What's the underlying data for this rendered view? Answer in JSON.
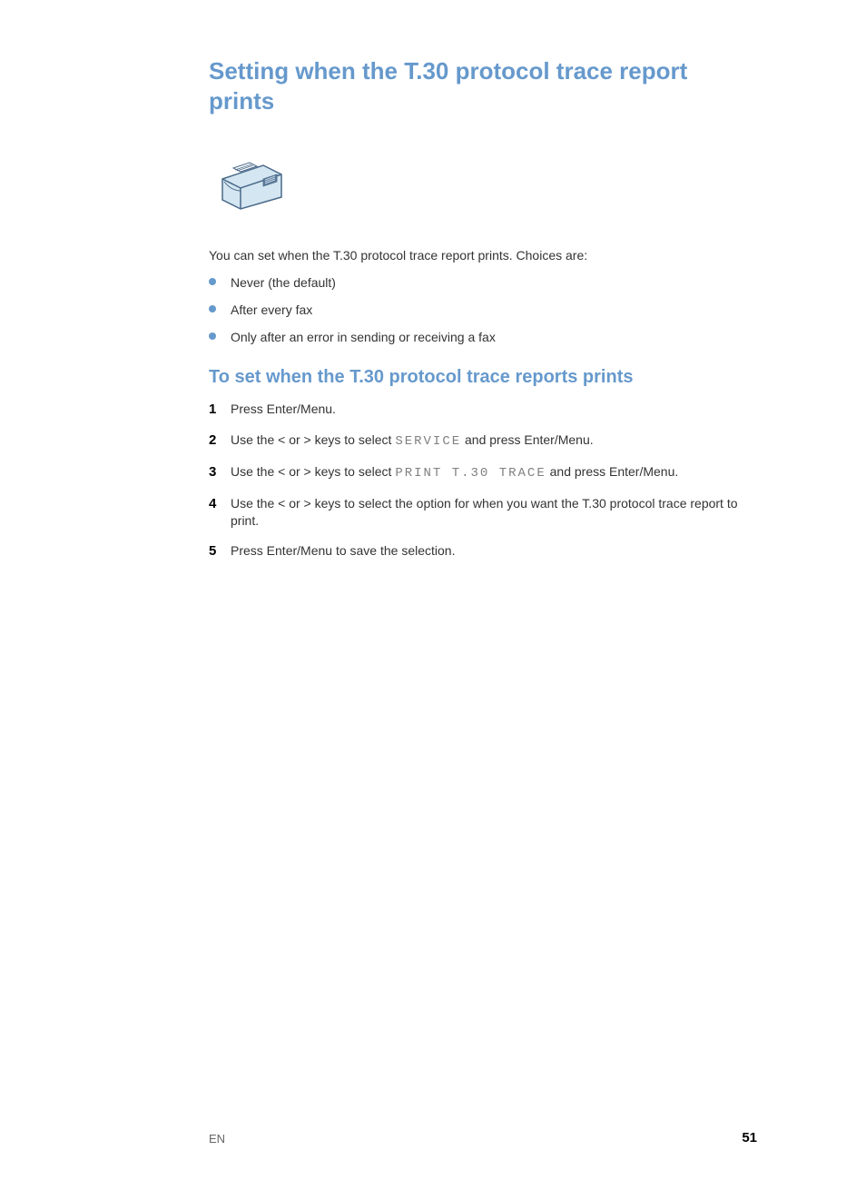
{
  "heading": "Setting when the T.30 protocol trace report prints",
  "intro": "You can set when the T.30 protocol trace report prints. Choices are:",
  "bullets": [
    "Never (the default)",
    "After every fax",
    "Only after an error in sending or receiving a fax"
  ],
  "subheading": "To set when the T.30 protocol trace reports prints",
  "steps": [
    {
      "num": "1",
      "pre": "Press Enter/Menu.",
      "lcd": "",
      "post": ""
    },
    {
      "num": "2",
      "pre": "Use the < or > keys to select ",
      "lcd": "SERVICE",
      "post": " and press Enter/Menu."
    },
    {
      "num": "3",
      "pre": "Use the < or > keys to select ",
      "lcd": "PRINT T.30 TRACE",
      "post": " and press Enter/Menu."
    },
    {
      "num": "4",
      "pre": "Use the < or > keys to select the option for when you want the T.30 protocol trace report to print.",
      "lcd": "",
      "post": ""
    },
    {
      "num": "5",
      "pre": "Press Enter/Menu to save the selection.",
      "lcd": "",
      "post": ""
    }
  ],
  "footer_label": "EN",
  "page_number": "51"
}
